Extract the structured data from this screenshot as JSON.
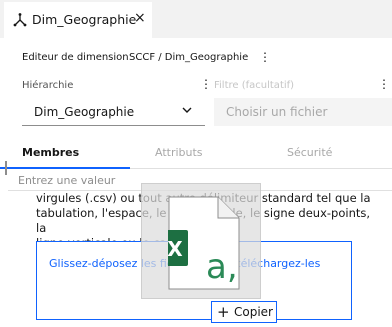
{
  "tab": {
    "title": "Dim_Geographie",
    "close_glyph": "×",
    "icon": "hierarchy-icon"
  },
  "editor": {
    "label": "Editeur de dimension",
    "path": "SCCF / Dim_Geographie",
    "menu_glyph": "⋮"
  },
  "hierarchy": {
    "label": "Hiérarchie",
    "value": "Dim_Geographie",
    "chevron_glyph": "⌄",
    "menu_glyph": "⋮"
  },
  "filter": {
    "label": "Filtre (facultatif)",
    "placeholder": "Choisir un fichier",
    "menu_glyph": "⋮"
  },
  "subtabs": {
    "members": "Membres",
    "attributes": "Attributs",
    "security": "Sécurité"
  },
  "search": {
    "placeholder": "Entrez une valeur"
  },
  "body": {
    "line1": "virgules (.csv) ou tout autre délimiteur standard tel que la",
    "line2": "tabulation, l'espace, le point-virgule, le signe deux-points, la",
    "line3": "ligne verticale ou le caret (^)."
  },
  "dropzone": {
    "text": "Glissez-déposez les fichiers ici ou téléchargez-les"
  },
  "drag": {
    "excel_letter": "X",
    "file_letter": "a,",
    "copy_plus": "+",
    "copy_label": "Copier"
  },
  "colors": {
    "accent": "#0f62fe",
    "excel_green": "#1d6f42"
  }
}
